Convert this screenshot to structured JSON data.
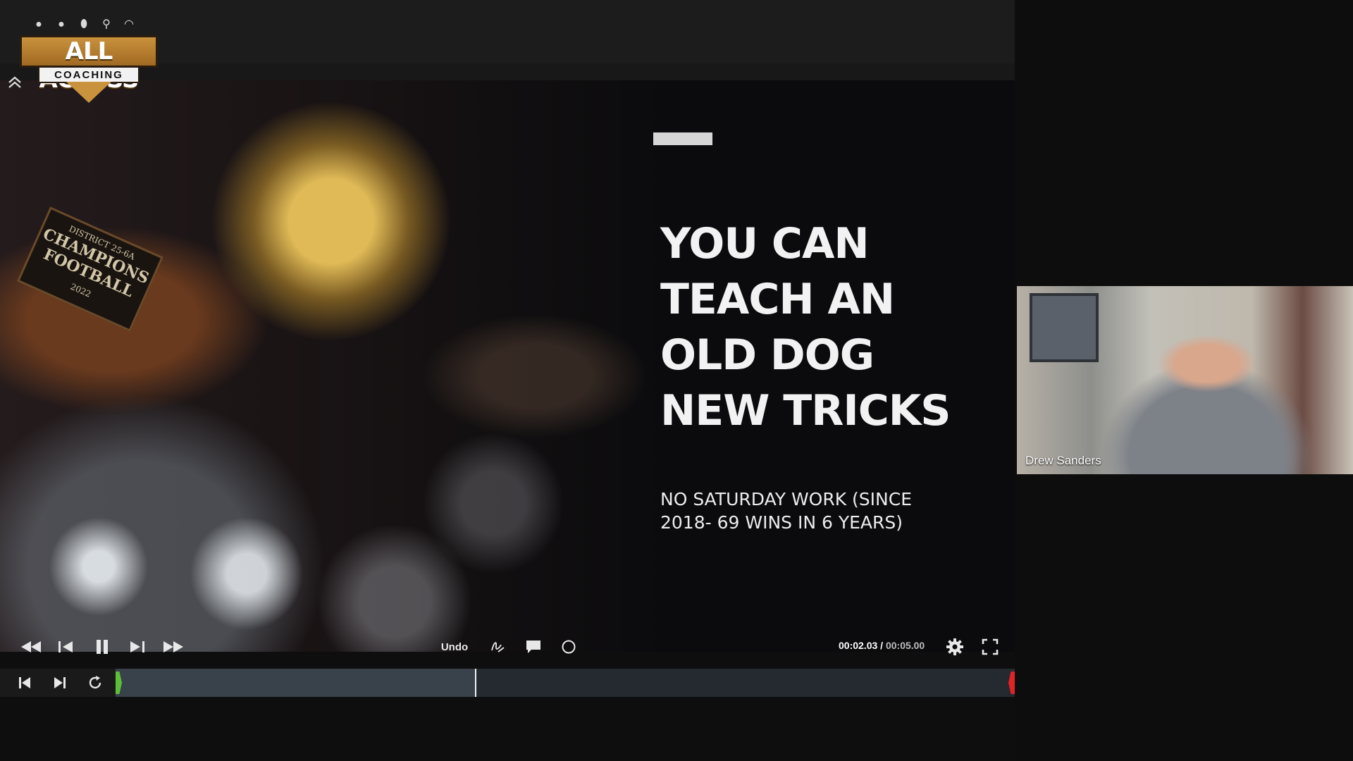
{
  "logo": {
    "title": "ALL ACCESS",
    "subtitle": "COACHING",
    "icons": [
      "baseball-icon",
      "volleyball-icon",
      "football-icon",
      "lacrosse-icon",
      "helmet-icon"
    ]
  },
  "slide": {
    "title_lines": [
      "YOU CAN",
      "TEACH AN",
      "OLD DOG",
      "NEW TRICKS"
    ],
    "subtitle_lines": [
      "NO SATURDAY WORK (SINCE",
      "2018- 69 WINS IN 6 YEARS)"
    ],
    "trophy_plate": [
      "CHAMPIONS",
      "FOOTBALL"
    ],
    "trophy_small": "DISTRICT 25-6A",
    "trophy_year": "2022"
  },
  "player": {
    "undo_label": "Undo",
    "current_time": "00:02.03",
    "separator": " / ",
    "duration": "00:05.00",
    "played_fraction": 0.4
  },
  "participant": {
    "name": "Drew Sanders"
  },
  "colors": {
    "logo_gold": "#c9923d",
    "start_marker": "#5cbf3a",
    "end_marker": "#e02424"
  }
}
